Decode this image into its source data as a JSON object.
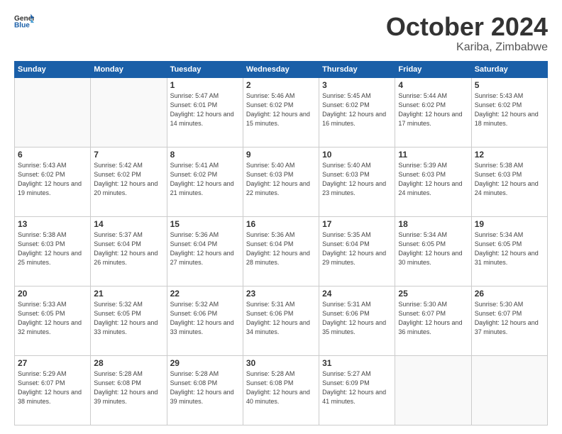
{
  "header": {
    "logo_general": "General",
    "logo_blue": "Blue",
    "month": "October 2024",
    "location": "Kariba, Zimbabwe"
  },
  "days_of_week": [
    "Sunday",
    "Monday",
    "Tuesday",
    "Wednesday",
    "Thursday",
    "Friday",
    "Saturday"
  ],
  "weeks": [
    [
      {
        "day": "",
        "info": ""
      },
      {
        "day": "",
        "info": ""
      },
      {
        "day": "1",
        "info": "Sunrise: 5:47 AM\nSunset: 6:01 PM\nDaylight: 12 hours\nand 14 minutes."
      },
      {
        "day": "2",
        "info": "Sunrise: 5:46 AM\nSunset: 6:02 PM\nDaylight: 12 hours\nand 15 minutes."
      },
      {
        "day": "3",
        "info": "Sunrise: 5:45 AM\nSunset: 6:02 PM\nDaylight: 12 hours\nand 16 minutes."
      },
      {
        "day": "4",
        "info": "Sunrise: 5:44 AM\nSunset: 6:02 PM\nDaylight: 12 hours\nand 17 minutes."
      },
      {
        "day": "5",
        "info": "Sunrise: 5:43 AM\nSunset: 6:02 PM\nDaylight: 12 hours\nand 18 minutes."
      }
    ],
    [
      {
        "day": "6",
        "info": "Sunrise: 5:43 AM\nSunset: 6:02 PM\nDaylight: 12 hours\nand 19 minutes."
      },
      {
        "day": "7",
        "info": "Sunrise: 5:42 AM\nSunset: 6:02 PM\nDaylight: 12 hours\nand 20 minutes."
      },
      {
        "day": "8",
        "info": "Sunrise: 5:41 AM\nSunset: 6:02 PM\nDaylight: 12 hours\nand 21 minutes."
      },
      {
        "day": "9",
        "info": "Sunrise: 5:40 AM\nSunset: 6:03 PM\nDaylight: 12 hours\nand 22 minutes."
      },
      {
        "day": "10",
        "info": "Sunrise: 5:40 AM\nSunset: 6:03 PM\nDaylight: 12 hours\nand 23 minutes."
      },
      {
        "day": "11",
        "info": "Sunrise: 5:39 AM\nSunset: 6:03 PM\nDaylight: 12 hours\nand 24 minutes."
      },
      {
        "day": "12",
        "info": "Sunrise: 5:38 AM\nSunset: 6:03 PM\nDaylight: 12 hours\nand 24 minutes."
      }
    ],
    [
      {
        "day": "13",
        "info": "Sunrise: 5:38 AM\nSunset: 6:03 PM\nDaylight: 12 hours\nand 25 minutes."
      },
      {
        "day": "14",
        "info": "Sunrise: 5:37 AM\nSunset: 6:04 PM\nDaylight: 12 hours\nand 26 minutes."
      },
      {
        "day": "15",
        "info": "Sunrise: 5:36 AM\nSunset: 6:04 PM\nDaylight: 12 hours\nand 27 minutes."
      },
      {
        "day": "16",
        "info": "Sunrise: 5:36 AM\nSunset: 6:04 PM\nDaylight: 12 hours\nand 28 minutes."
      },
      {
        "day": "17",
        "info": "Sunrise: 5:35 AM\nSunset: 6:04 PM\nDaylight: 12 hours\nand 29 minutes."
      },
      {
        "day": "18",
        "info": "Sunrise: 5:34 AM\nSunset: 6:05 PM\nDaylight: 12 hours\nand 30 minutes."
      },
      {
        "day": "19",
        "info": "Sunrise: 5:34 AM\nSunset: 6:05 PM\nDaylight: 12 hours\nand 31 minutes."
      }
    ],
    [
      {
        "day": "20",
        "info": "Sunrise: 5:33 AM\nSunset: 6:05 PM\nDaylight: 12 hours\nand 32 minutes."
      },
      {
        "day": "21",
        "info": "Sunrise: 5:32 AM\nSunset: 6:05 PM\nDaylight: 12 hours\nand 33 minutes."
      },
      {
        "day": "22",
        "info": "Sunrise: 5:32 AM\nSunset: 6:06 PM\nDaylight: 12 hours\nand 33 minutes."
      },
      {
        "day": "23",
        "info": "Sunrise: 5:31 AM\nSunset: 6:06 PM\nDaylight: 12 hours\nand 34 minutes."
      },
      {
        "day": "24",
        "info": "Sunrise: 5:31 AM\nSunset: 6:06 PM\nDaylight: 12 hours\nand 35 minutes."
      },
      {
        "day": "25",
        "info": "Sunrise: 5:30 AM\nSunset: 6:07 PM\nDaylight: 12 hours\nand 36 minutes."
      },
      {
        "day": "26",
        "info": "Sunrise: 5:30 AM\nSunset: 6:07 PM\nDaylight: 12 hours\nand 37 minutes."
      }
    ],
    [
      {
        "day": "27",
        "info": "Sunrise: 5:29 AM\nSunset: 6:07 PM\nDaylight: 12 hours\nand 38 minutes."
      },
      {
        "day": "28",
        "info": "Sunrise: 5:28 AM\nSunset: 6:08 PM\nDaylight: 12 hours\nand 39 minutes."
      },
      {
        "day": "29",
        "info": "Sunrise: 5:28 AM\nSunset: 6:08 PM\nDaylight: 12 hours\nand 39 minutes."
      },
      {
        "day": "30",
        "info": "Sunrise: 5:28 AM\nSunset: 6:08 PM\nDaylight: 12 hours\nand 40 minutes."
      },
      {
        "day": "31",
        "info": "Sunrise: 5:27 AM\nSunset: 6:09 PM\nDaylight: 12 hours\nand 41 minutes."
      },
      {
        "day": "",
        "info": ""
      },
      {
        "day": "",
        "info": ""
      }
    ]
  ]
}
